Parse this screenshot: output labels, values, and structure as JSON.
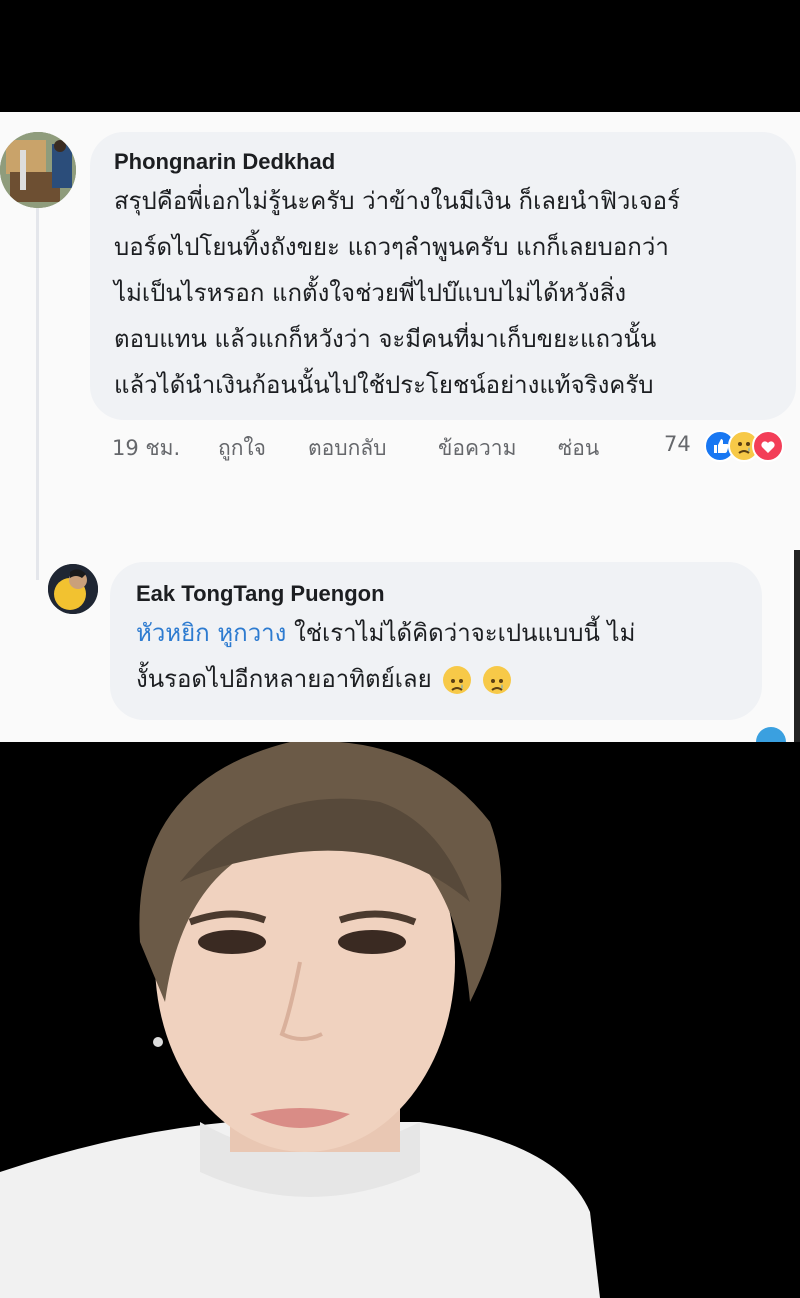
{
  "comments": [
    {
      "author": "Phongnarin Dedkhad",
      "lines": [
        "สรุปคือพี่เอกไม่รู้นะครับ ว่าข้างในมีเงิน ก็เลยนำฟิวเจอร์",
        "บอร์ดไปโยนทิ้งถังขยะ แถวๆลำพูนครับ แกก็เลยบอกว่า",
        "ไม่เป็นไรหรอก แกตั้งใจช่วยพี่ไปบ๊แบบไม่ได้หวังสิ่ง",
        "ตอบแทน แล้วแกก็หวังว่า จะมีคนที่มาเก็บขยะแถวนั้น",
        "แล้วได้นำเงินก้อนนั้นไปใช้ประโยชน์อย่างแท้จริงครับ"
      ],
      "time": "19 ชม.",
      "like_label": "ถูกใจ",
      "reply_label": "ตอบกลับ",
      "message_label": "ข้อความ",
      "hide_label": "ซ่อน",
      "reaction_count": "74",
      "reactions": [
        "like-icon",
        "sad-icon",
        "love-icon"
      ]
    },
    {
      "author": "Eak TongTang Puengon",
      "mention": "หัวหยิก หูกวาง",
      "line1_rest": " ใช่เราไม่ได้คิดว่าจะเปนแบบนี้ ไม่",
      "line2": "งั้นรอดไปอีกหลายอาทิตย์เลย",
      "emojis": [
        "crying-face-icon",
        "crying-face-icon"
      ]
    }
  ],
  "colors": {
    "bubble": "#f0f2f5",
    "mention": "#2d7bd0",
    "meta_text": "#65676b",
    "like": "#1877f2",
    "love": "#f33e58",
    "sad": "#f7c948"
  }
}
